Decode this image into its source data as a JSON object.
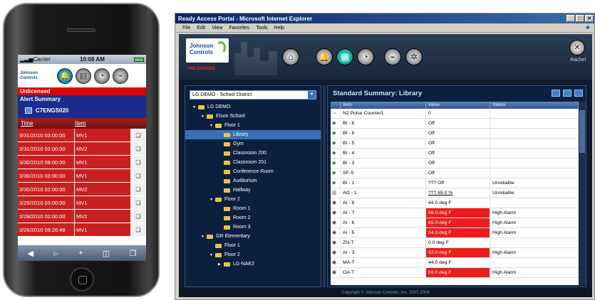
{
  "mobile": {
    "carrier": "Carrier",
    "time": "10:08 AM",
    "logo": "Johnson Controls",
    "unlicensed": "Unlicensed",
    "section_title": "Alert Summary",
    "device": "C7ENGS020",
    "table_headers": {
      "time": "Time",
      "item": "Item"
    },
    "rows": [
      {
        "time": "3/31/2010 03:00:00",
        "item": "MV1"
      },
      {
        "time": "3/31/2010 02:00:00",
        "item": "MV2"
      },
      {
        "time": "3/30/2010 08:00:00",
        "item": "MV1"
      },
      {
        "time": "3/30/2010 03:00:00",
        "item": "MV1"
      },
      {
        "time": "3/30/2010 02:00:00",
        "item": "MV2"
      },
      {
        "time": "3/29/2010 03:00:00",
        "item": "MV1"
      },
      {
        "time": "3/29/2010 02:00:00",
        "item": "MV2"
      },
      {
        "time": "3/26/2010 09:26:48",
        "item": "MV1"
      }
    ]
  },
  "browser": {
    "window_title": "Ready Access Portal - Microsoft Internet Explorer",
    "menu": [
      "File",
      "Edit",
      "View",
      "Favorites",
      "Tools",
      "Help"
    ],
    "header": {
      "logo_line1": "Johnson",
      "logo_line2": "Controls",
      "unlicensed": "UNLICENSED",
      "user": "Rachel"
    },
    "site_select": "LG DEMO - School District",
    "tree": [
      {
        "label": "LG DEMO",
        "level": 0,
        "expanded": true
      },
      {
        "label": "Elson School",
        "level": 1,
        "expanded": true
      },
      {
        "label": "Floor 1",
        "level": 2,
        "expanded": true
      },
      {
        "label": "Library",
        "level": 3,
        "selected": true
      },
      {
        "label": "Gym",
        "level": 3
      },
      {
        "label": "Classroom 200",
        "level": 3
      },
      {
        "label": "Classroom 201",
        "level": 3
      },
      {
        "label": "Conference Room",
        "level": 3
      },
      {
        "label": "Auditorium",
        "level": 3
      },
      {
        "label": "Hallway",
        "level": 3
      },
      {
        "label": "Floor 2",
        "level": 2,
        "expanded": true
      },
      {
        "label": "Room 1",
        "level": 3
      },
      {
        "label": "Room 2",
        "level": 3
      },
      {
        "label": "Room 3",
        "level": 3
      },
      {
        "label": "GR Elementary",
        "level": 1,
        "expanded": true
      },
      {
        "label": "Floor 1",
        "level": 2
      },
      {
        "label": "Floor 2",
        "level": 2,
        "expanded": true
      },
      {
        "label": "LG-NAE2",
        "level": 3,
        "collapsed": true
      }
    ],
    "summary": {
      "title": "Standard Summary:  Library",
      "columns": [
        "Item",
        "Value",
        "Status"
      ],
      "rows": [
        {
          "icon": "n2-icon",
          "item": "N2 Pulse Counter1",
          "value": "0",
          "status": ""
        },
        {
          "icon": "bi-icon",
          "item": "BI - 8",
          "value": "Off",
          "status": ""
        },
        {
          "icon": "bi-icon",
          "item": "BI - 6",
          "value": "Off",
          "status": ""
        },
        {
          "icon": "bi-icon",
          "item": "BI - 5",
          "value": "Off",
          "status": ""
        },
        {
          "icon": "bi-icon",
          "item": "BI - 4",
          "value": "Off",
          "status": ""
        },
        {
          "icon": "bi-icon",
          "item": "BI - 3",
          "value": "Off",
          "status": ""
        },
        {
          "icon": "bi-icon",
          "item": "SF-S",
          "value": "Off",
          "status": ""
        },
        {
          "icon": "bi-icon",
          "item": "BI - 1",
          "value": "??? Off",
          "status": "Unreliable"
        },
        {
          "icon": "ao-icon",
          "item": "AO - 1",
          "value": "??? 65.0 %",
          "status": "Unreliable",
          "link": true
        },
        {
          "icon": "ai-icon",
          "item": "AI - 8",
          "value": "44.0 deg F",
          "status": ""
        },
        {
          "icon": "ai-icon",
          "item": "AI - 7",
          "value": "66.0 deg F",
          "status": "High Alarm",
          "alarm": true
        },
        {
          "icon": "ai-icon",
          "item": "AI - 6",
          "value": "65.0 deg F",
          "status": "High Alarm",
          "alarm": true
        },
        {
          "icon": "ai-icon",
          "item": "AI - 5",
          "value": "64.0 deg F",
          "status": "High Alarm",
          "alarm": true
        },
        {
          "icon": "ai-icon",
          "item": "ZN-T",
          "value": "0.0 deg F",
          "status": ""
        },
        {
          "icon": "ai-icon",
          "item": "AI - 3",
          "value": "62.0 deg F",
          "status": "High Alarm",
          "alarm": true
        },
        {
          "icon": "ai-icon",
          "item": "MA-T",
          "value": "44.0 deg F",
          "status": ""
        },
        {
          "icon": "ai-icon",
          "item": "OA-T",
          "value": "66.0 deg F",
          "status": "High Alarm",
          "alarm": true
        }
      ]
    },
    "footer": "Copyright © Johnson Controls, Inc. 2007-2009"
  },
  "colors": {
    "alarm": "#ee1d1d",
    "nav_blue": "#1c2c8c",
    "mobile_red": "#c82020",
    "selected": "#3a6fb8"
  }
}
